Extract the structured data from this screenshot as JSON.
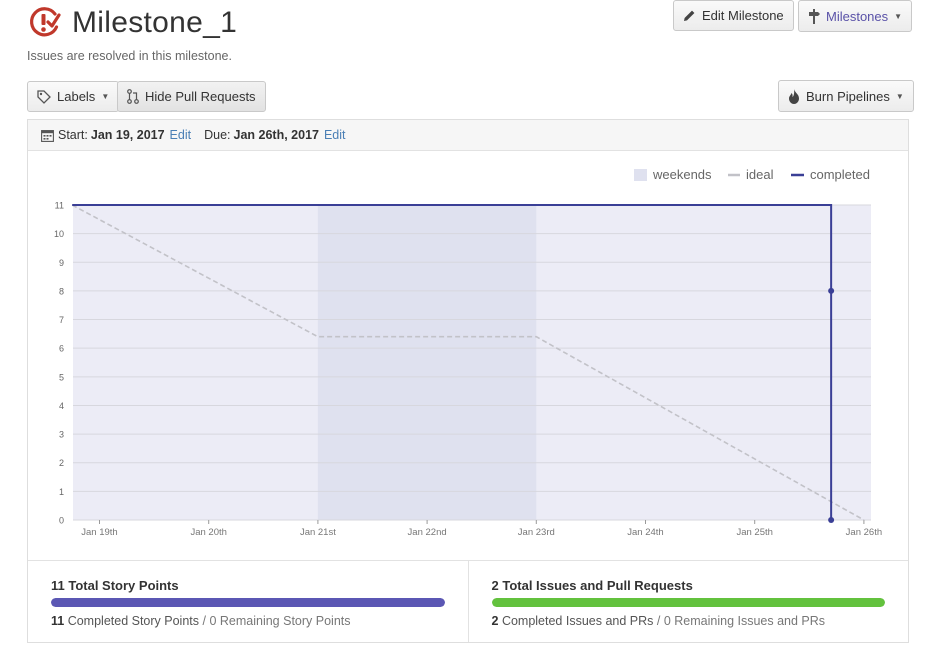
{
  "milestone": {
    "title": "Milestone_1",
    "description": "Issues are resolved in this milestone."
  },
  "toolbar": {
    "edit_label": "Edit Milestone",
    "milestones_label": "Milestones",
    "labels_label": "Labels",
    "hide_pr_label": "Hide Pull Requests",
    "burn_label": "Burn Pipelines"
  },
  "dates": {
    "start_label": "Start:",
    "start_value": "Jan 19, 2017",
    "due_label": "Due:",
    "due_value": "Jan 26th, 2017",
    "edit_label": "Edit"
  },
  "colors": {
    "accent": "#5a52a8",
    "completed_line": "#3a3f96",
    "ideal_line": "#c2c2c8",
    "plot_bg": "#ececf6",
    "weekend_bg": "#dfe1ef",
    "story_bar": "#5b57b4",
    "issues_bar": "#63c23e",
    "milestone_icon": "#c0382b"
  },
  "chart_data": {
    "type": "line",
    "title": "",
    "xlabel": "",
    "ylabel": "",
    "ylim": [
      0,
      11
    ],
    "yticks": [
      0,
      1,
      2,
      3,
      4,
      5,
      6,
      7,
      8,
      9,
      10,
      11
    ],
    "x_tick_labels": [
      "Jan 19th",
      "Jan 20th",
      "Jan 21st",
      "Jan 22nd",
      "Jan 23rd",
      "Jan 24th",
      "Jan 25th",
      "Jan 26th"
    ],
    "xlim_days": [
      0,
      7
    ],
    "legend": [
      "weekends",
      "ideal",
      "completed"
    ],
    "legend_position": "top-right",
    "weekends": [
      [
        2,
        4
      ]
    ],
    "series": [
      {
        "name": "ideal",
        "points": [
          [
            -0.25,
            11
          ],
          [
            2,
            6.4
          ],
          [
            4,
            6.4
          ],
          [
            7,
            0
          ]
        ]
      },
      {
        "name": "completed",
        "points": [
          [
            -0.25,
            11
          ],
          [
            6.7,
            11
          ],
          [
            6.7,
            8
          ],
          [
            6.7,
            0
          ]
        ]
      }
    ]
  },
  "stats": {
    "story": {
      "title": "11 Total Story Points",
      "completed_count": "11",
      "completed_text": "Completed Story Points",
      "remaining_text": "0 Remaining Story Points",
      "progress": 1.0
    },
    "issues": {
      "title": "2 Total Issues and Pull Requests",
      "completed_count": "2",
      "completed_text": "Completed Issues and PRs",
      "remaining_text": "0 Remaining Issues and PRs",
      "progress": 1.0
    }
  }
}
